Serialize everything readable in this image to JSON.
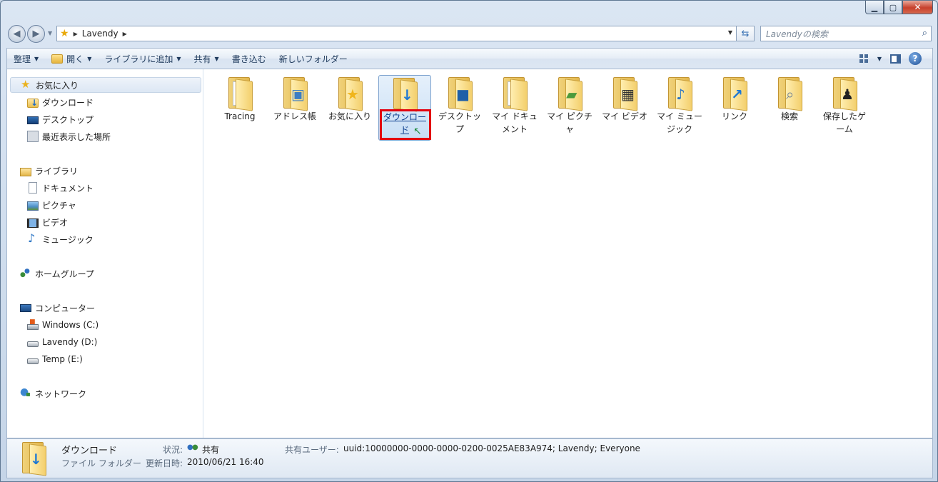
{
  "address": {
    "crumb": "Lavendy"
  },
  "search": {
    "placeholder": "Lavendyの検索"
  },
  "toolbar": {
    "organize": "整理",
    "open": "開く",
    "add_to_library": "ライブラリに追加",
    "share": "共有",
    "burn": "書き込む",
    "new_folder": "新しいフォルダー"
  },
  "sidebar": {
    "favorites": "お気に入り",
    "favorites_items": [
      "ダウンロード",
      "デスクトップ",
      "最近表示した場所"
    ],
    "libraries": "ライブラリ",
    "libraries_items": [
      "ドキュメント",
      "ピクチャ",
      "ビデオ",
      "ミュージック"
    ],
    "homegroup": "ホームグループ",
    "computer": "コンピューター",
    "computer_items": [
      "Windows (C:)",
      "Lavendy (D:)",
      "Temp (E:)"
    ],
    "network": "ネットワーク"
  },
  "files": [
    {
      "name": "Tracing",
      "icon": "document-folder-icon"
    },
    {
      "name": "アドレス帳",
      "icon": "contacts-folder-icon"
    },
    {
      "name": "お気に入り",
      "icon": "favorites-folder-icon"
    },
    {
      "name": "ダウンロード",
      "icon": "downloads-folder-icon",
      "selected": true
    },
    {
      "name": "デスクトップ",
      "icon": "desktop-folder-icon"
    },
    {
      "name": "マイ ドキュメント",
      "icon": "documents-folder-icon"
    },
    {
      "name": "マイ ピクチャ",
      "icon": "pictures-folder-icon"
    },
    {
      "name": "マイ ビデオ",
      "icon": "videos-folder-icon"
    },
    {
      "name": "マイ ミュージック",
      "icon": "music-folder-icon"
    },
    {
      "name": "リンク",
      "icon": "links-folder-icon"
    },
    {
      "name": "検索",
      "icon": "searches-folder-icon"
    },
    {
      "name": "保存したゲーム",
      "icon": "saved-games-folder-icon"
    }
  ],
  "details": {
    "name": "ダウンロード",
    "type": "ファイル フォルダー",
    "status_label": "状況:",
    "status_value": "共有",
    "modified_label": "更新日時:",
    "modified_value": "2010/06/21 16:40",
    "shared_with_label": "共有ユーザー:",
    "shared_with_value": "uuid:10000000-0000-0000-0200-0025AE83A974; Lavendy; Everyone"
  },
  "colors": {
    "highlight_border": "#e3000f",
    "selection": "#c8def5"
  }
}
